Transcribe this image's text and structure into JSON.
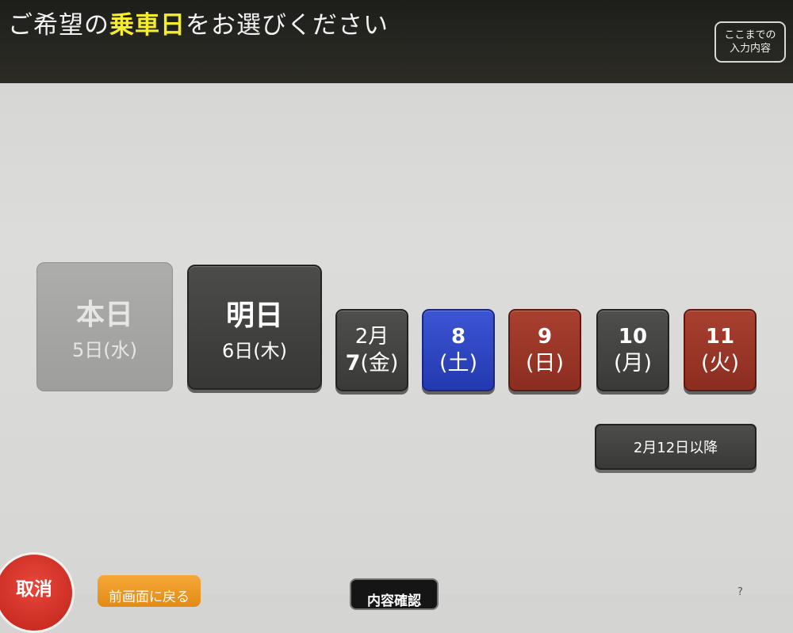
{
  "header": {
    "title_prefix": "ご希望の",
    "title_highlight": "乗車日",
    "title_suffix": "をお選びください",
    "summary_line1": "ここまでの",
    "summary_line2": "入力内容"
  },
  "days": {
    "today": {
      "label": "本日",
      "date": "5日(水)"
    },
    "tomorrow": {
      "label": "明日",
      "date": "6日(木)"
    },
    "d7": {
      "line1": "2月",
      "line2_num": "7",
      "line2_wd": "(金)"
    },
    "d8": {
      "num": "8",
      "wd": "(土)"
    },
    "d9": {
      "num": "9",
      "wd": "(日)"
    },
    "d10": {
      "num": "10",
      "wd": "(月)"
    },
    "d11": {
      "num": "11",
      "wd": "(火)"
    }
  },
  "later_button": "2月12日以降",
  "footer": {
    "cancel": "取消",
    "back": "前画面に戻る",
    "confirm": "内容確認",
    "corner": "?"
  },
  "colors": {
    "title_highlight": "#f4ec2c",
    "weekday": "#3b3b39",
    "saturday": "#2c44c4",
    "holiday": "#9a3526",
    "cancel": "#d6342a",
    "back": "#ef9a25"
  }
}
